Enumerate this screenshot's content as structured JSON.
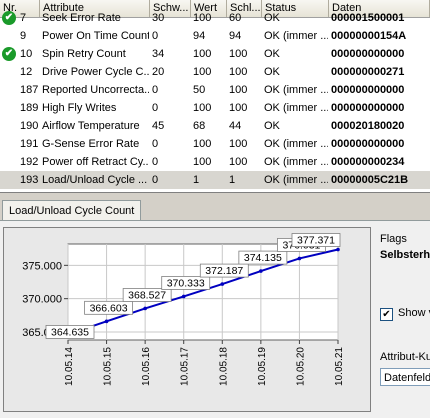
{
  "table": {
    "columns": [
      "Nr.",
      "Attribute",
      "Schw...",
      "Wert",
      "Schl...",
      "Status",
      "Daten"
    ],
    "rows": [
      {
        "nr": "7",
        "attr": "Seek Error Rate",
        "schw": "30",
        "wert": "100",
        "schl": "60",
        "status": "OK",
        "daten": "000001500001",
        "icon": true,
        "selected": false
      },
      {
        "nr": "9",
        "attr": "Power On Time Count",
        "schw": "0",
        "wert": "94",
        "schl": "94",
        "status": "OK (immer ...",
        "daten": "00000000154A",
        "icon": false,
        "selected": false
      },
      {
        "nr": "10",
        "attr": "Spin Retry Count",
        "schw": "34",
        "wert": "100",
        "schl": "100",
        "status": "OK",
        "daten": "000000000000",
        "icon": true,
        "selected": false
      },
      {
        "nr": "12",
        "attr": "Drive Power Cycle C...",
        "schw": "20",
        "wert": "100",
        "schl": "100",
        "status": "OK",
        "daten": "000000000271",
        "icon": false,
        "selected": false
      },
      {
        "nr": "187",
        "attr": "Reported Uncorrecta...",
        "schw": "0",
        "wert": "50",
        "schl": "100",
        "status": "OK (immer ...",
        "daten": "000000000000",
        "icon": false,
        "selected": false
      },
      {
        "nr": "189",
        "attr": "High Fly Writes",
        "schw": "0",
        "wert": "100",
        "schl": "100",
        "status": "OK (immer ...",
        "daten": "000000000000",
        "icon": false,
        "selected": false
      },
      {
        "nr": "190",
        "attr": "Airflow Temperature",
        "schw": "45",
        "wert": "68",
        "schl": "44",
        "status": "OK",
        "daten": "000020180020",
        "icon": false,
        "selected": false
      },
      {
        "nr": "191",
        "attr": "G-Sense Error Rate",
        "schw": "0",
        "wert": "100",
        "schl": "100",
        "status": "OK (immer ...",
        "daten": "000000000000",
        "icon": false,
        "selected": false
      },
      {
        "nr": "192",
        "attr": "Power off Retract Cy...",
        "schw": "0",
        "wert": "100",
        "schl": "100",
        "status": "OK (immer ...",
        "daten": "000000000234",
        "icon": false,
        "selected": false
      },
      {
        "nr": "193",
        "attr": "Load/Unload Cycle ...",
        "schw": "0",
        "wert": "1",
        "schl": "1",
        "status": "OK (immer ...",
        "daten": "00000005C21B",
        "icon": false,
        "selected": true
      }
    ]
  },
  "tab_label": "Load/Unload Cycle Count",
  "right_panel": {
    "flags_label": "Flags",
    "flags_value": "Selbsterh",
    "show_label": "Show v",
    "show_checked": "✔",
    "attr_label": "Attribut-Ku",
    "attr_field": "Datenfeld"
  },
  "chart_data": {
    "type": "line",
    "x": [
      "10.05.14",
      "10.05.15",
      "10.05.16",
      "10.05.17",
      "10.05.18",
      "10.05.19",
      "10.05.20",
      "10.05.21"
    ],
    "values": [
      364635,
      366603,
      368527,
      370333,
      372187,
      374135,
      376031,
      377371
    ],
    "point_labels": [
      "364.635",
      "366.603",
      "368.527",
      "370.333",
      "372.187",
      "374.135",
      "376.031",
      "377.371"
    ],
    "y_ticks": [
      "365.000",
      "370.000",
      "375.000"
    ],
    "y_tick_values": [
      365000,
      370000,
      375000
    ],
    "ylim": [
      363800,
      378200
    ],
    "grid": true,
    "line_color": "#0000c0"
  }
}
